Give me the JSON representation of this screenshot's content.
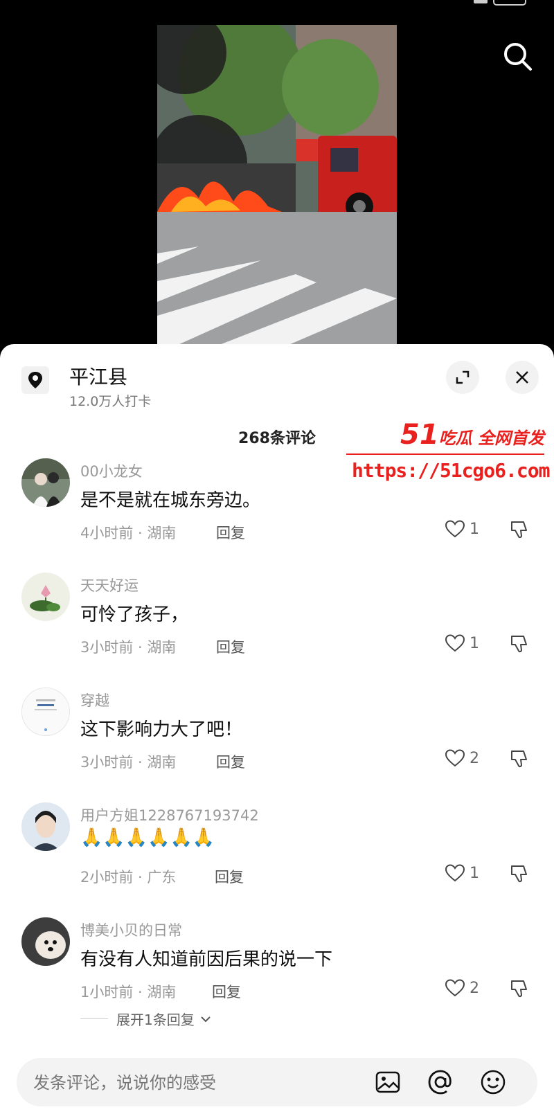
{
  "status": {
    "time": ""
  },
  "location": {
    "title": "平江县",
    "checkins": "12.0万人打卡"
  },
  "comments_header": {
    "count_label": "268条评论"
  },
  "watermark": {
    "brand_num": "51",
    "brand_text": "吃瓜 全网首发",
    "url": "https://51cgo6.com"
  },
  "comments": [
    {
      "user": "00小龙女",
      "text": "是不是就在城东旁边。",
      "meta": "4小时前 · 湖南",
      "reply": "回复",
      "likes": "1"
    },
    {
      "user": "天天好运",
      "text": "可怜了孩子，",
      "meta": "3小时前 · 湖南",
      "reply": "回复",
      "likes": "1"
    },
    {
      "user": "穿越",
      "text": "这下影响力大了吧！",
      "meta": "3小时前 · 湖南",
      "reply": "回复",
      "likes": "2"
    },
    {
      "user": "用户方姐1228767193742",
      "text": "🙏🙏🙏🙏🙏🙏",
      "meta": "2小时前 · 广东",
      "reply": "回复",
      "likes": "1"
    },
    {
      "user": "博美小贝的日常",
      "text": "有没有人知道前因后果的说一下",
      "meta": "1小时前 · 湖南",
      "reply": "回复",
      "likes": "2"
    }
  ],
  "expand_replies": "展开1条回复",
  "input": {
    "placeholder": "发条评论，说说你的感受"
  },
  "icons": {
    "search": "search-icon",
    "location": "location-pin-icon",
    "expand": "expand-icon",
    "close": "close-icon",
    "like": "heart-icon",
    "dislike": "thumbs-down-icon",
    "image": "image-icon",
    "at": "at-icon",
    "emoji": "emoji-icon"
  },
  "colors": {
    "watermark": "#e8201e",
    "sheet": "#ffffff",
    "background": "#000000"
  }
}
